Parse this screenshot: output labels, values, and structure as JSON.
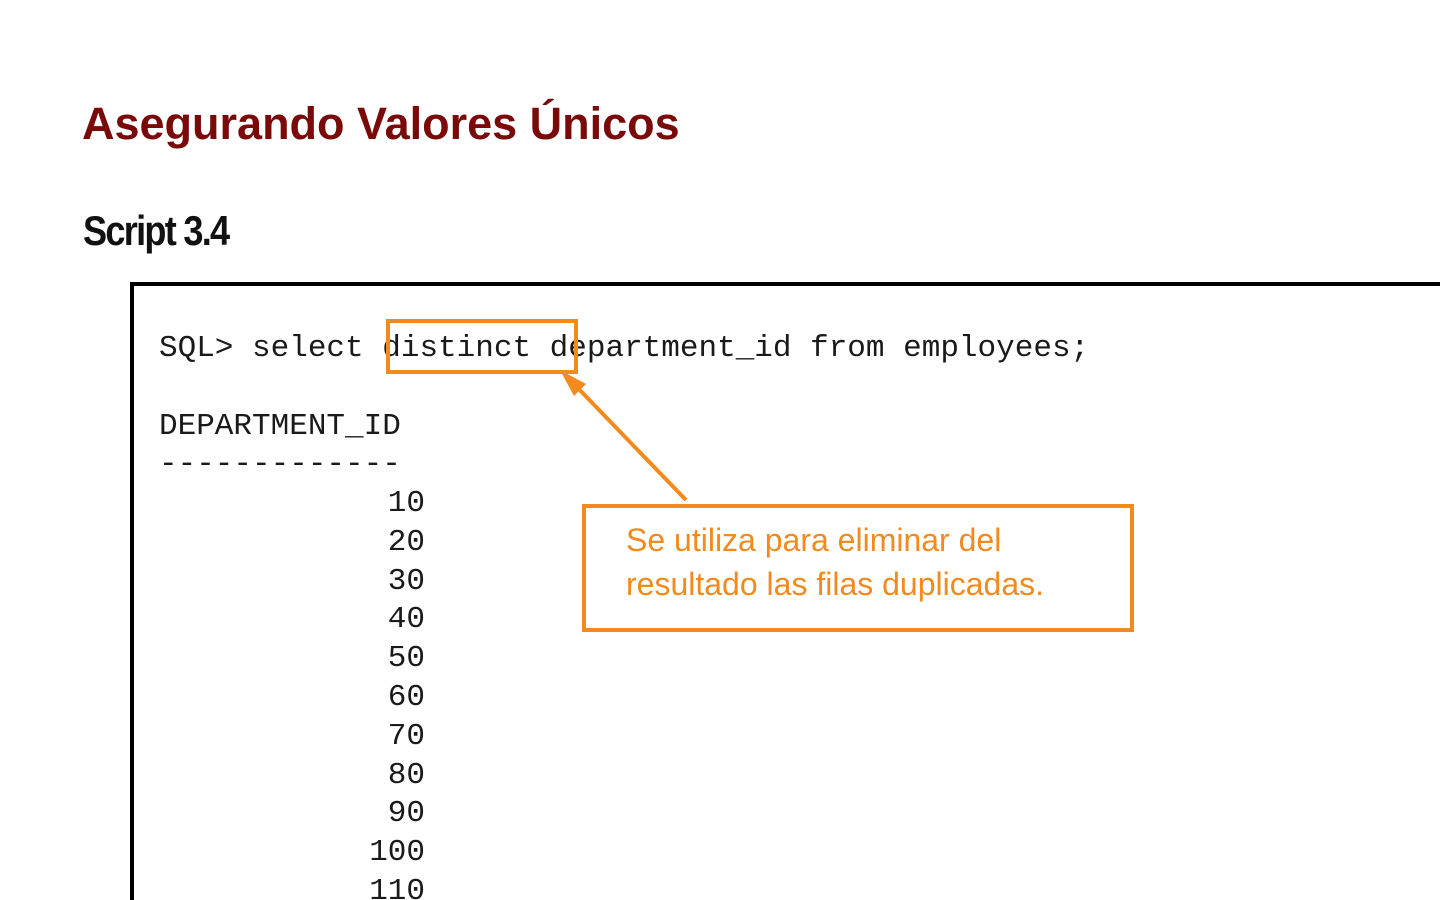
{
  "document": {
    "title": "Asegurando Valores Únicos",
    "subtitle": "Script 3.4"
  },
  "code": {
    "command": "SQL> select distinct department_id from employees;",
    "column_header": "DEPARTMENT_ID",
    "column_rule": "-------------",
    "values": [
      "10",
      "20",
      "30",
      "40",
      "50",
      "60",
      "70",
      "80",
      "90",
      "100",
      "110"
    ]
  },
  "annotation": {
    "highlighted_keyword": "distinct",
    "callout_line1": "Se utiliza para eliminar del",
    "callout_line2": "resultado las filas duplicadas.",
    "accent_color": "#f28a1e"
  },
  "colors": {
    "title": "#7a0a0a",
    "subtitle": "#111111",
    "code_text": "#1a1a1a"
  }
}
